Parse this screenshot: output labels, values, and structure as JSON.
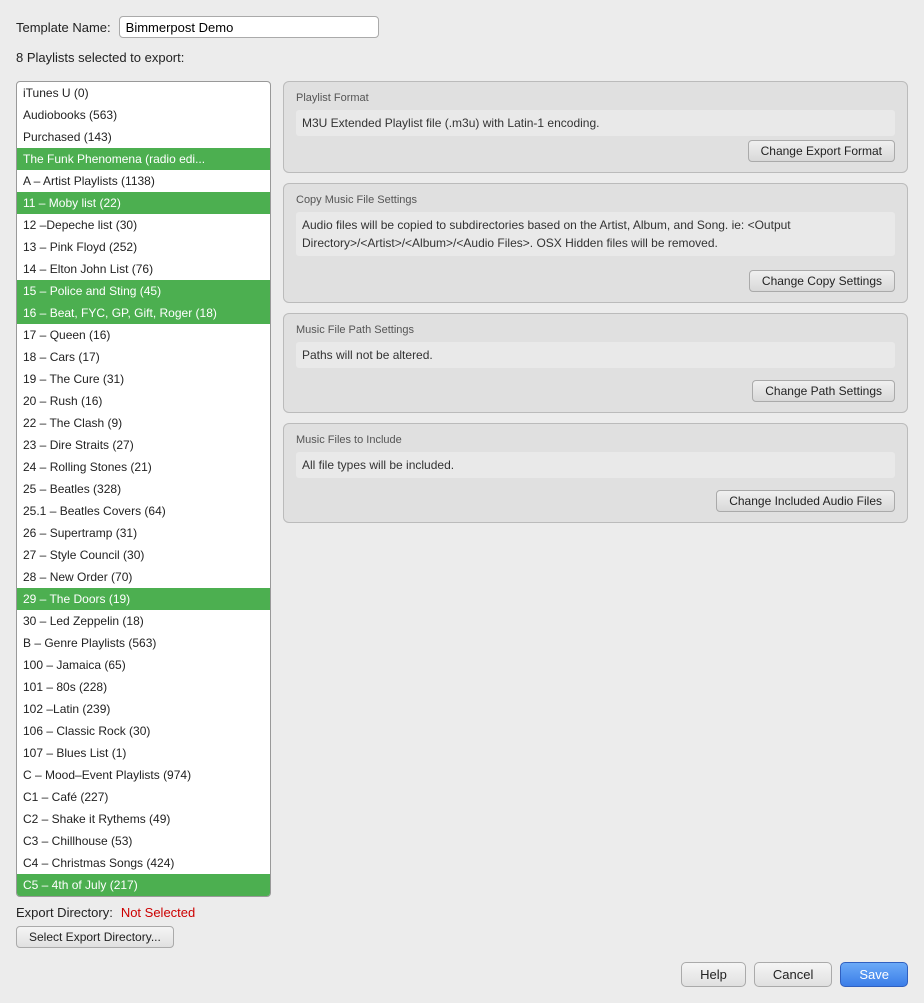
{
  "template": {
    "label": "Template Name:",
    "value": "Bimmerpost Demo"
  },
  "playlists_count_label": "8 Playlists selected to export:",
  "playlist_items": [
    {
      "id": 0,
      "label": "iTunes U (0)",
      "selected": false
    },
    {
      "id": 1,
      "label": "Audiobooks (563)",
      "selected": false
    },
    {
      "id": 2,
      "label": "Purchased (143)",
      "selected": false
    },
    {
      "id": 3,
      "label": "The Funk Phenomena (radio edi...",
      "selected": true
    },
    {
      "id": 4,
      "label": "A – Artist Playlists (1138)",
      "selected": false
    },
    {
      "id": 5,
      "label": "11 – Moby list (22)",
      "selected": true
    },
    {
      "id": 6,
      "label": "12 –Depeche list (30)",
      "selected": false
    },
    {
      "id": 7,
      "label": "13 – Pink Floyd (252)",
      "selected": false
    },
    {
      "id": 8,
      "label": "14 – Elton John List (76)",
      "selected": false
    },
    {
      "id": 9,
      "label": "15 – Police and Sting (45)",
      "selected": true
    },
    {
      "id": 10,
      "label": "16 – Beat, FYC, GP, Gift, Roger (18)",
      "selected": true
    },
    {
      "id": 11,
      "label": "17 – Queen (16)",
      "selected": false
    },
    {
      "id": 12,
      "label": "18 – Cars (17)",
      "selected": false
    },
    {
      "id": 13,
      "label": "19 – The Cure (31)",
      "selected": false
    },
    {
      "id": 14,
      "label": "20 – Rush (16)",
      "selected": false
    },
    {
      "id": 15,
      "label": "22 – The Clash (9)",
      "selected": false
    },
    {
      "id": 16,
      "label": "23 – Dire Straits (27)",
      "selected": false
    },
    {
      "id": 17,
      "label": "24 – Rolling Stones (21)",
      "selected": false
    },
    {
      "id": 18,
      "label": "25 – Beatles (328)",
      "selected": false
    },
    {
      "id": 19,
      "label": "25.1 – Beatles Covers (64)",
      "selected": false
    },
    {
      "id": 20,
      "label": "26 – Supertramp (31)",
      "selected": false
    },
    {
      "id": 21,
      "label": "27 – Style Council (30)",
      "selected": false
    },
    {
      "id": 22,
      "label": "28 – New Order (70)",
      "selected": false
    },
    {
      "id": 23,
      "label": "29 – The Doors (19)",
      "selected": true
    },
    {
      "id": 24,
      "label": "30 – Led Zeppelin (18)",
      "selected": false
    },
    {
      "id": 25,
      "label": "B – Genre Playlists (563)",
      "selected": false
    },
    {
      "id": 26,
      "label": "100 – Jamaica (65)",
      "selected": false
    },
    {
      "id": 27,
      "label": "101 – 80s (228)",
      "selected": false
    },
    {
      "id": 28,
      "label": "102 –Latin (239)",
      "selected": false
    },
    {
      "id": 29,
      "label": "106 – Classic Rock (30)",
      "selected": false
    },
    {
      "id": 30,
      "label": "107 – Blues List (1)",
      "selected": false
    },
    {
      "id": 31,
      "label": "C – Mood–Event Playlists (974)",
      "selected": false
    },
    {
      "id": 32,
      "label": "C1 – Café (227)",
      "selected": false
    },
    {
      "id": 33,
      "label": "C2 – Shake it Rythems (49)",
      "selected": false
    },
    {
      "id": 34,
      "label": "C3 – Chillhouse (53)",
      "selected": false
    },
    {
      "id": 35,
      "label": "C4 – Christmas Songs (424)",
      "selected": false
    },
    {
      "id": 36,
      "label": "C5 – 4th of July (217)",
      "selected": true
    }
  ],
  "export_format": {
    "title": "Playlist Format",
    "description": "M3U Extended Playlist file (.m3u) with Latin-1 encoding.",
    "button_label": "Change Export Format"
  },
  "copy_settings": {
    "title": "Copy Music File Settings",
    "description": "Audio files will be copied to subdirectories based on the Artist, Album, and Song.  ie: <Output Directory>/<Artist>/<Album>/<Audio Files>. OSX Hidden files will be removed.",
    "button_label": "Change Copy Settings"
  },
  "path_settings": {
    "title": "Music File Path Settings",
    "description": "Paths will not be altered.",
    "button_label": "Change Path Settings"
  },
  "audio_files": {
    "title": "Music Files to Include",
    "description": "All file types will be included.",
    "button_label": "Change Included Audio Files"
  },
  "export_dir": {
    "label": "Export Directory:",
    "value": "Not Selected",
    "button_label": "Select Export Directory..."
  },
  "buttons": {
    "help": "Help",
    "cancel": "Cancel",
    "save": "Save"
  }
}
